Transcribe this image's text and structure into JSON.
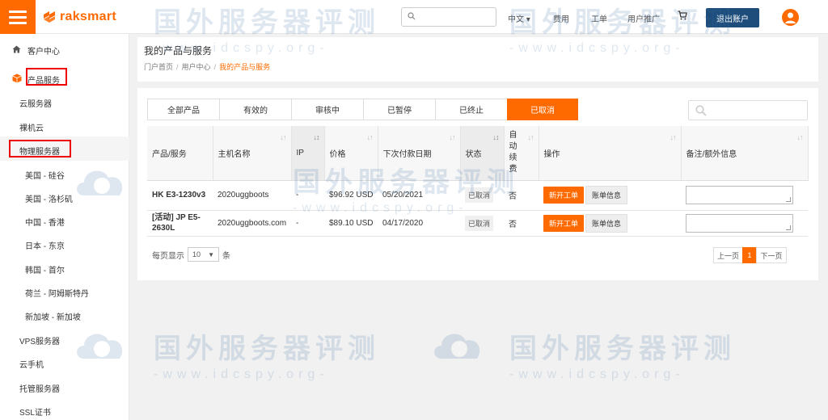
{
  "header": {
    "logo_text": "raksmart",
    "search": {
      "placeholder": ""
    },
    "nav": {
      "lang": "中文 ▾",
      "fees": "费用",
      "tickets": "工单",
      "affiliate": "用户推广"
    },
    "logout": "退出账户"
  },
  "sidebar": {
    "items": [
      {
        "label": "客户中心"
      },
      {
        "label": "产品服务"
      },
      {
        "label": "云服务器"
      },
      {
        "label": "裸机云"
      },
      {
        "label": "物理服务器"
      },
      {
        "label": "美国 - 硅谷"
      },
      {
        "label": "美国 - 洛杉矶"
      },
      {
        "label": "中国 - 香港"
      },
      {
        "label": "日本 - 东京"
      },
      {
        "label": "韩国 - 首尔"
      },
      {
        "label": "荷兰 - 阿姆斯特丹"
      },
      {
        "label": "新加坡 - 新加坡"
      },
      {
        "label": "VPS服务器"
      },
      {
        "label": "云手机"
      },
      {
        "label": "托管服务器"
      },
      {
        "label": "SSL证书"
      }
    ]
  },
  "page": {
    "title": "我的产品与服务",
    "breadcrumb": [
      "门户首页",
      "用户中心",
      "我的产品与服务"
    ]
  },
  "tabs": [
    "全部产品",
    "有效的",
    "审核中",
    "已暂停",
    "已终止",
    "已取消"
  ],
  "table": {
    "headers": [
      "产品/服务",
      "主机名称",
      "IP",
      "价格",
      "下次付款日期",
      "状态",
      "自动续费",
      "操作",
      "备注/额外信息"
    ],
    "rows": [
      {
        "product": "HK E3-1230v3",
        "host": "2020uggboots",
        "ip": "-",
        "price": "$96.92 USD",
        "next_due": "05/20/2021",
        "status": "已取消",
        "auto": "否",
        "new_ticket": "新开工单",
        "billing": "账单信息"
      },
      {
        "product": "[活动] JP E5-2630L",
        "host": "2020uggboots.com",
        "ip": "-",
        "price": "$89.10 USD",
        "next_due": "04/17/2020",
        "status": "已取消",
        "auto": "否",
        "new_ticket": "新开工单",
        "billing": "账单信息"
      }
    ]
  },
  "footer": {
    "per_page_label": "每页显示",
    "per_page_value": "10",
    "per_page_unit": "条",
    "prev": "上一页",
    "current_page": "1",
    "next": "下一页"
  },
  "watermark": {
    "title": "国外服务器评测",
    "url": "-www.idcspy.org-"
  },
  "colors": {
    "accent": "#ff6a00",
    "logout_bg": "#1e4d7b"
  }
}
